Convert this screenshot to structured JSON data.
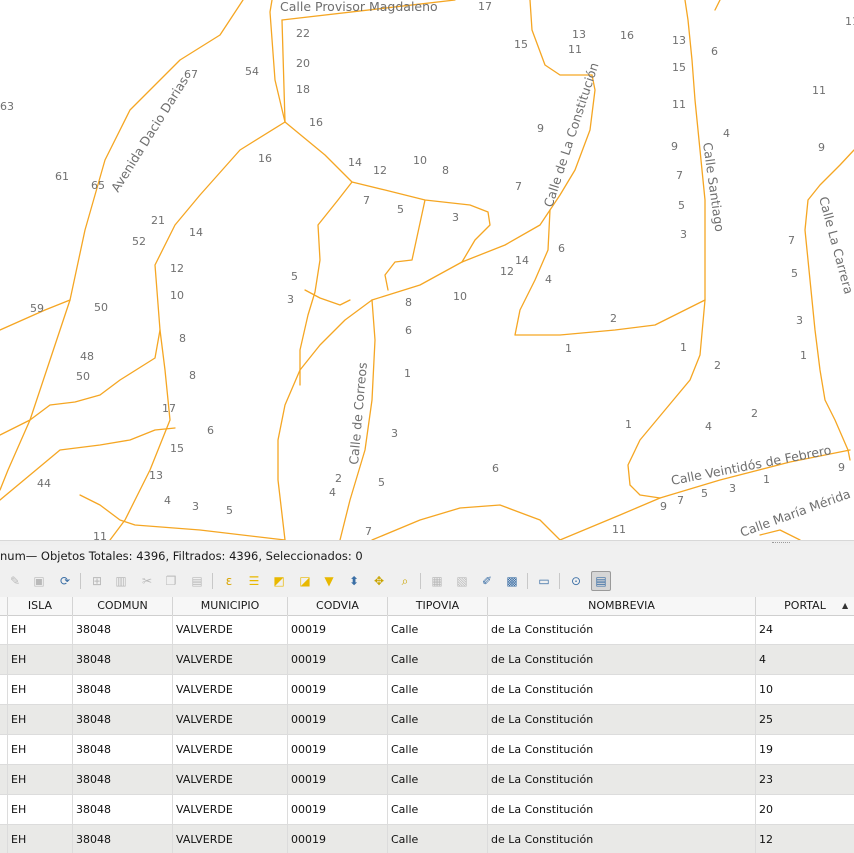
{
  "map": {
    "streets": [
      {
        "name": "Calle Provisor Magdaleno"
      },
      {
        "name": "Avenida Dacio Darias"
      },
      {
        "name": "Calle de La Constitución"
      },
      {
        "name": "Calle Santiago"
      },
      {
        "name": "Calle La Carrera"
      },
      {
        "name": "Calle de Correos"
      },
      {
        "name": "Calle Veintidós de Febrero"
      },
      {
        "name": "Calle María Mérida"
      }
    ],
    "numbers": [
      "17",
      "22",
      "20",
      "18",
      "16",
      "54",
      "67",
      "63",
      "61",
      "65",
      "16",
      "14",
      "12",
      "10",
      "8",
      "7",
      "5",
      "3",
      "21",
      "52",
      "14",
      "12",
      "10",
      "8",
      "8",
      "17",
      "15",
      "13",
      "6",
      "4",
      "3",
      "5",
      "44",
      "11",
      "59",
      "50",
      "48",
      "50",
      "5",
      "3",
      "13",
      "11",
      "15",
      "16",
      "13",
      "15",
      "6",
      "9",
      "7",
      "11",
      "9",
      "7",
      "5",
      "3",
      "4",
      "6",
      "14",
      "12",
      "4",
      "2",
      "1",
      "1",
      "10",
      "8",
      "6",
      "1",
      "3",
      "4",
      "2",
      "5",
      "7",
      "6",
      "1",
      "2",
      "4",
      "2",
      "1",
      "9",
      "7",
      "5",
      "3",
      "11",
      "9",
      "11",
      "7",
      "5",
      "3",
      "1",
      "11",
      "9"
    ]
  },
  "attribute_table": {
    "title": "num— Objetos Totales: 4396, Filtrados: 4396, Seleccionados: 0",
    "toolbar_icons": [
      "edit-pencil-icon",
      "save-edits-icon",
      "reload-icon",
      "add-feature-icon",
      "delete-feature-icon",
      "cut-icon",
      "copy-icon",
      "paste-icon",
      "expression-select-icon",
      "select-all-icon",
      "invert-selection-icon",
      "deselect-icon",
      "filter-icon",
      "move-selection-top-icon",
      "pan-to-selection-icon",
      "zoom-to-selection-icon",
      "new-field-icon",
      "delete-field-icon",
      "field-calculator-icon",
      "conditional-formatting-icon",
      "dock-icon",
      "actions-icon",
      "zoom-map-icon",
      "form-view-icon"
    ],
    "columns": [
      "ISLA",
      "CODMUN",
      "MUNICIPIO",
      "CODVIA",
      "TIPOVIA",
      "NOMBREVIA",
      "PORTAL"
    ],
    "rows": [
      [
        "EH",
        "38048",
        "VALVERDE",
        "00019",
        "Calle",
        "de La Constitución",
        "24"
      ],
      [
        "EH",
        "38048",
        "VALVERDE",
        "00019",
        "Calle",
        "de La Constitución",
        "4"
      ],
      [
        "EH",
        "38048",
        "VALVERDE",
        "00019",
        "Calle",
        "de La Constitución",
        "10"
      ],
      [
        "EH",
        "38048",
        "VALVERDE",
        "00019",
        "Calle",
        "de La Constitución",
        "25"
      ],
      [
        "EH",
        "38048",
        "VALVERDE",
        "00019",
        "Calle",
        "de La Constitución",
        "19"
      ],
      [
        "EH",
        "38048",
        "VALVERDE",
        "00019",
        "Calle",
        "de La Constitución",
        "23"
      ],
      [
        "EH",
        "38048",
        "VALVERDE",
        "00019",
        "Calle",
        "de La Constitución",
        "20"
      ],
      [
        "EH",
        "38048",
        "VALVERDE",
        "00019",
        "Calle",
        "de La Constitución",
        "12"
      ]
    ]
  },
  "colors": {
    "road": "#f5a623",
    "label": "#707070",
    "alt_row": "#e9e9e7"
  }
}
